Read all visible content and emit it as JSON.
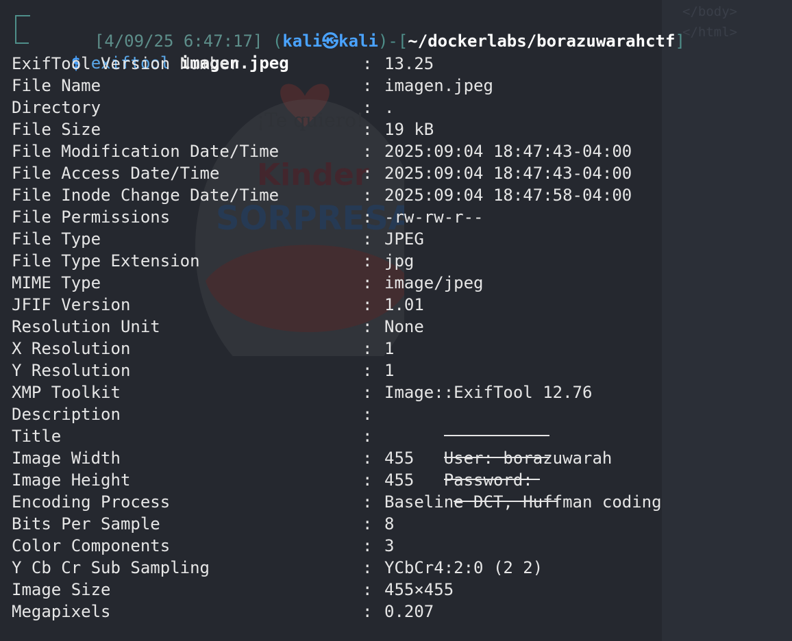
{
  "prompt": {
    "timestamp": "[4/09/25 6:47:17]",
    "user": "kali",
    "host": "kali",
    "at_symbol": "㉿",
    "path": "~/dockerlabs/borazuwarahctf",
    "symbol": "$",
    "command": "exiftool",
    "argument": "imagen.jpeg"
  },
  "background": {
    "ghost_lines": [
      "</body>",
      "</html>"
    ],
    "art_texts": [
      "¡Te quiero!",
      "Kinder",
      "SORPRESA"
    ]
  },
  "rows": [
    {
      "key": "ExifTool Version Number",
      "value": "13.25"
    },
    {
      "key": "File Name",
      "value": "imagen.jpeg"
    },
    {
      "key": "Directory",
      "value": "."
    },
    {
      "key": "File Size",
      "value": "19 kB"
    },
    {
      "key": "File Modification Date/Time",
      "value": "2025:09:04 18:47:43-04:00"
    },
    {
      "key": "File Access Date/Time",
      "value": "2025:09:04 18:47:43-04:00"
    },
    {
      "key": "File Inode Change Date/Time",
      "value": "2025:09:04 18:47:58-04:00"
    },
    {
      "key": "File Permissions",
      "value": "-rw-rw-r--"
    },
    {
      "key": "File Type",
      "value": "JPEG"
    },
    {
      "key": "File Type Extension",
      "value": "jpg"
    },
    {
      "key": "MIME Type",
      "value": "image/jpeg"
    },
    {
      "key": "JFIF Version",
      "value": "1.01"
    },
    {
      "key": "Resolution Unit",
      "value": "None"
    },
    {
      "key": "X Resolution",
      "value": "1"
    },
    {
      "key": "Y Resolution",
      "value": "1"
    },
    {
      "key": "XMP Toolkit",
      "value": "Image::ExifTool 12.76"
    },
    {
      "key": "Description",
      "value": "User: borazuwarah"
    },
    {
      "key": "Title",
      "value": "Password:"
    },
    {
      "key": "Image Width",
      "value": "455"
    },
    {
      "key": "Image Height",
      "value": "455"
    },
    {
      "key": "Encoding Process",
      "value": "Baseline DCT, Huffman coding"
    },
    {
      "key": "Bits Per Sample",
      "value": "8"
    },
    {
      "key": "Color Components",
      "value": "3"
    },
    {
      "key": "Y Cb Cr Sub Sampling",
      "value": "YCbCr4:2:0 (2 2)"
    },
    {
      "key": "Image Size",
      "value": "455×455"
    },
    {
      "key": "Megapixels",
      "value": "0.207"
    }
  ],
  "colon": ":"
}
